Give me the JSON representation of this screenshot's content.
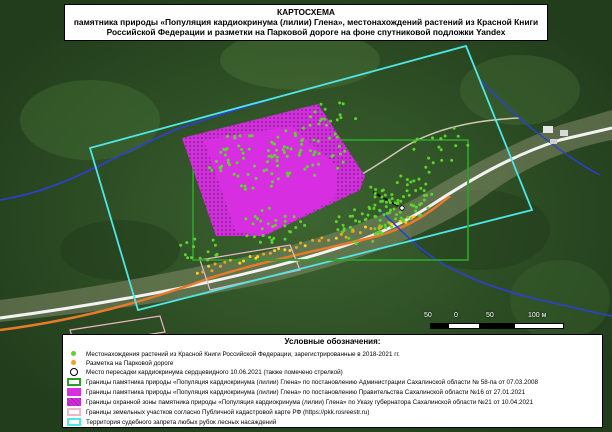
{
  "title": {
    "line1": "КАРТОСХЕМА",
    "line2": "памятника природы «Популяция кардиокринума (лилии) Глена», местонахождений растений из Красной Книги",
    "line3": "Российской Федерации и разметки на Парковой дороге на фоне спутниковой подложки Yandex"
  },
  "scale": {
    "labels": [
      "50",
      "0",
      "50",
      "100 м"
    ]
  },
  "legend": {
    "title": "Условные обозначения:",
    "items": [
      {
        "symbol": "dot-green",
        "text": "Местонахождения растений из Красной Книги Российской Федерации, зарегистрированные в 2018-2021 гг."
      },
      {
        "symbol": "dot-orange",
        "text": "Разметка на Парковой дороге"
      },
      {
        "symbol": "circle-open",
        "text": "Место пересадки кардиокринума сердцевидного 10.06.2021 (также помечено стрелкой)"
      },
      {
        "symbol": "rect-green",
        "text": "Границы памятника природы «Популяция кардиокринума (лилии) Глена» по постановлению Администрации Сахалинской области № 58-па от 07.03.2008"
      },
      {
        "symbol": "rect-magenta",
        "text": "Границы памятника природы «Популяция кардиокринума (лилии) Глена» по постановлению Правительства Сахалинской области №16 от 27.01.2021"
      },
      {
        "symbol": "rect-hatched",
        "text": "Границы охранной зоны памятника природы «Популяция кардиокринума (лилии) Глена» по Указу губернатора Сахалинской области №21 от 10.04.2021"
      },
      {
        "symbol": "rect-pink",
        "text": "Границы земельных участков согласно Публичной кадастровой карте РФ (https://pkk.rosreestr.ru)"
      },
      {
        "symbol": "rect-cyan",
        "text": "Территория судебного запрета любых рубок лесных насаждений"
      }
    ]
  },
  "colors": {
    "forest": "#2b4a22",
    "road_orange": "#e87a2a",
    "road_white": "#f2f2f2",
    "boundary_green": "#2e9e2a",
    "zone_magenta": "#d72ee2",
    "cadastre_pink": "#f0b6c7",
    "court_cyan": "#4ee6e6",
    "river_blue": "#2d3fd8"
  }
}
